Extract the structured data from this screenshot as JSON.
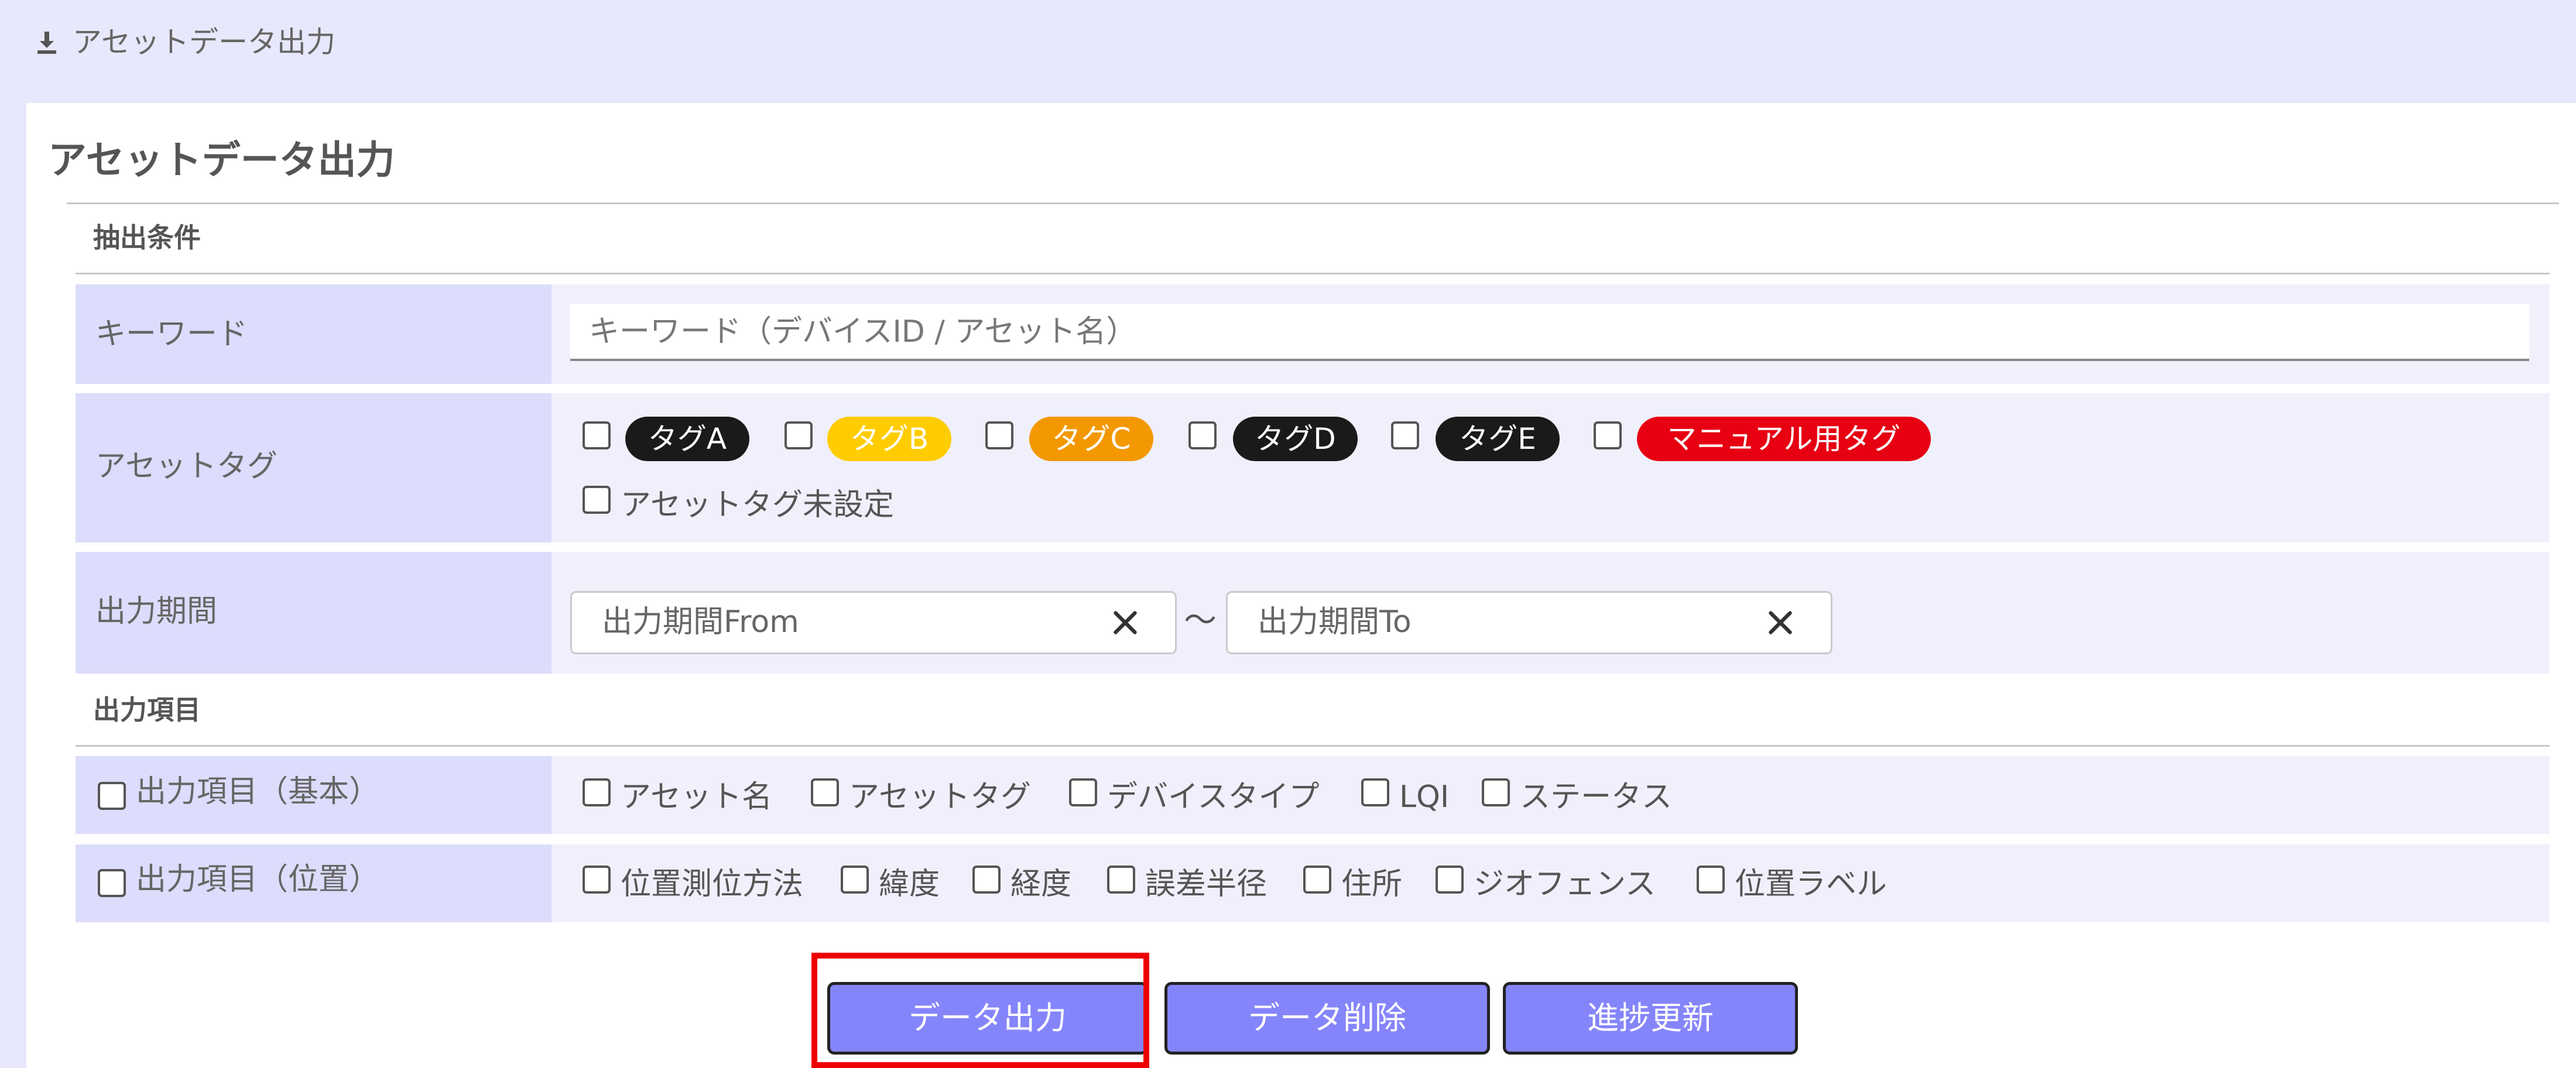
{
  "header": {
    "title": "アセットデータ出力",
    "icon": "download-icon"
  },
  "page": {
    "title": "アセットデータ出力"
  },
  "extraction": {
    "section_title": "抽出条件",
    "keyword": {
      "label": "キーワード",
      "placeholder": "キーワード（デバイスID / アセット名）"
    },
    "asset_tag": {
      "label": "アセットタグ",
      "tags": [
        {
          "label": "タグA",
          "color": "#1a1a1a"
        },
        {
          "label": "タグB",
          "color": "#ffcc00"
        },
        {
          "label": "タグC",
          "color": "#f39800"
        },
        {
          "label": "タグD",
          "color": "#1a1a1a"
        },
        {
          "label": "タグE",
          "color": "#1a1a1a"
        },
        {
          "label": "マニュアル用タグ",
          "color": "#e60012"
        }
      ],
      "untagged_label": "アセットタグ未設定"
    },
    "period": {
      "label": "出力期間",
      "from_placeholder": "出力期間From",
      "to_placeholder": "出力期間To",
      "separator": "〜"
    }
  },
  "output_items": {
    "section_title": "出力項目",
    "basic": {
      "label": "出力項目（基本）",
      "options": [
        "アセット名",
        "アセットタグ",
        "デバイスタイプ",
        "LQI",
        "ステータス"
      ]
    },
    "location": {
      "label": "出力項目（位置）",
      "options": [
        "位置測位方法",
        "緯度",
        "経度",
        "誤差半径",
        "住所",
        "ジオフェンス",
        "位置ラベル"
      ]
    }
  },
  "buttons": {
    "export": "データ出力",
    "delete": "データ削除",
    "refresh": "進捗更新"
  },
  "colors": {
    "accent": "#8585fb",
    "highlight": "#ee0000"
  }
}
